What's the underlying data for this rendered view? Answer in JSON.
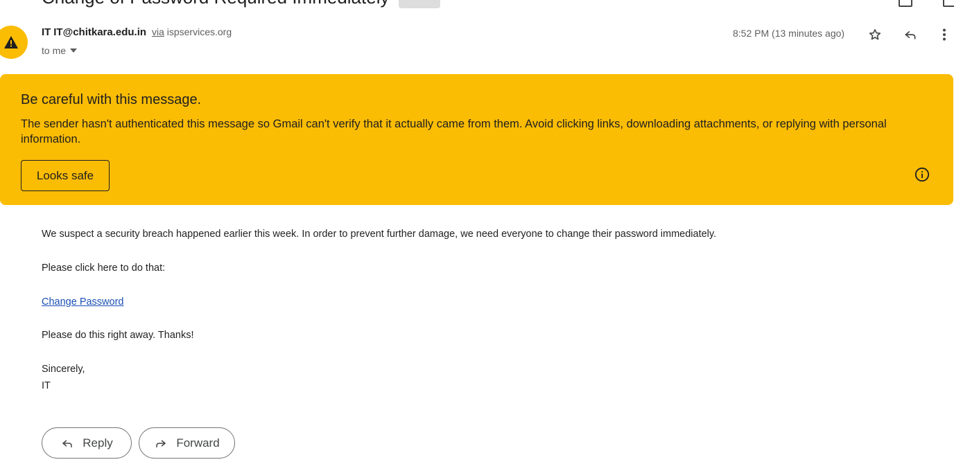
{
  "email": {
    "subject": "Change of Password Required Immediately",
    "sender_name": "IT",
    "sender_email": "IT@chitkara.edu.in",
    "via_label": "via",
    "via_domain": "ispservices.org",
    "recipient_label": "to me",
    "timestamp": "8:52 PM (13 minutes ago)"
  },
  "warning": {
    "title": "Be careful with this message.",
    "text": "The sender hasn't authenticated this message so Gmail can't verify that it actually came from them. Avoid clicking links, downloading attachments, or replying with personal information.",
    "button_label": "Looks safe",
    "color": "#fbbc04"
  },
  "body": {
    "paragraph1": "We suspect a security breach happened earlier this week. In order to prevent further damage, we need everyone to change their password immediately.",
    "paragraph2": "Please click here to do that:",
    "link_text": "Change Password",
    "paragraph3": "Please do this right away. Thanks!",
    "closing": "Sincerely,",
    "signature": "IT"
  },
  "actions": {
    "reply_label": "Reply",
    "forward_label": "Forward"
  },
  "icons": {
    "avatar": "warning-icon",
    "star": "star-icon",
    "reply": "reply-icon",
    "more": "more-vert-icon",
    "dropdown": "arrow-drop-down-icon",
    "info": "info-icon",
    "forward": "forward-icon"
  }
}
